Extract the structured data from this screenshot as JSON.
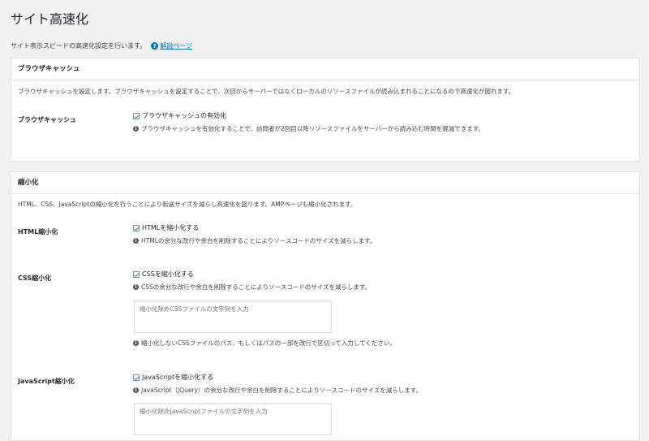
{
  "page": {
    "title": "サイト高速化",
    "intro": "サイト表示スピードの高速化設定を行います。",
    "help_link": "解説ページ"
  },
  "browser_cache": {
    "header": "ブラウザキャッシュ",
    "description": "ブラウザキャッシュを設定します。ブラウザキャッシュを設定することで、次回からサーバーではなくローカルのリソースファイルが読み込まれることになるので高速化が図れます。",
    "row_label": "ブラウザキャッシュ",
    "checkbox_label": "ブラウザキャッシュの有効化",
    "checkbox_checked": true,
    "note": "ブラウザキャッシュを有効化することで、訪問者が2回目以降リソースファイルをサーバーから読み込む時間を軽減できます。"
  },
  "minify": {
    "header": "縮小化",
    "description": "HTML、CSS、JavaScriptの縮小化を行うことにより転送サイズを減らし高速化を図ります。AMPページも縮小化されます。",
    "html": {
      "row_label": "HTML縮小化",
      "checkbox_label": "HTMLを縮小化する",
      "checkbox_checked": true,
      "note": "HTMLの余分な改行や余白を削除することによりソースコードのサイズを減らします。"
    },
    "css": {
      "row_label": "CSS縮小化",
      "checkbox_label": "CSSを縮小化する",
      "checkbox_checked": true,
      "note": "CSSの余分な改行や余白を削除することによりソースコードのサイズを減らします。",
      "textarea_placeholder": "縮小化除外CSSファイルの文字列を入力",
      "textarea_note": "縮小化しないCSSファイルのパス、もしくはパスの一部を改行で区切って入力してください。"
    },
    "js": {
      "row_label": "JavaScript縮小化",
      "checkbox_label": "JavaScriptを縮小化する",
      "checkbox_checked": true,
      "note": "JavaScript（jQuery）の余分な改行や余白を削除することによりソースコードのサイズを減らします。",
      "textarea_placeholder": "縮小化除外JavaScriptファイルの文字列を入力"
    }
  },
  "colors": {
    "link": "#0073aa",
    "background": "#f1f1f1"
  }
}
